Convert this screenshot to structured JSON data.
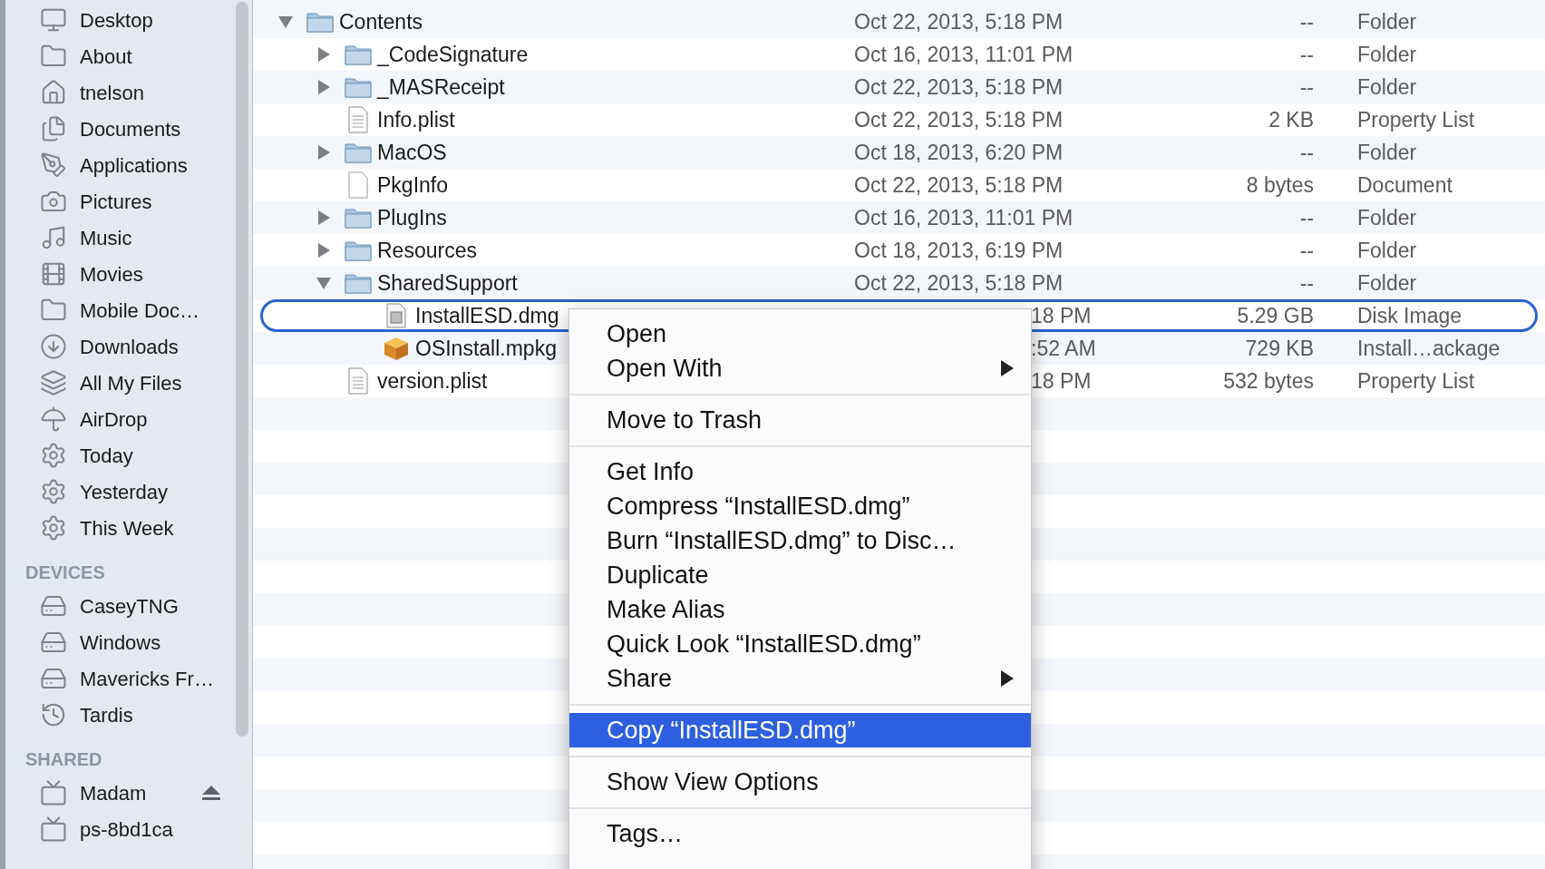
{
  "sidebar": {
    "favorites": [
      {
        "label": "Desktop"
      },
      {
        "label": "About"
      },
      {
        "label": "tnelson"
      },
      {
        "label": "Documents"
      },
      {
        "label": "Applications"
      },
      {
        "label": "Pictures"
      },
      {
        "label": "Music"
      },
      {
        "label": "Movies"
      },
      {
        "label": "Mobile Doc…"
      },
      {
        "label": "Downloads"
      },
      {
        "label": "All My Files"
      },
      {
        "label": "AirDrop"
      },
      {
        "label": "Today"
      },
      {
        "label": "Yesterday"
      },
      {
        "label": "This Week"
      }
    ],
    "sections": [
      {
        "title": "DEVICES",
        "items": [
          {
            "label": "CaseyTNG",
            "ejectable": false
          },
          {
            "label": "Windows",
            "ejectable": false
          },
          {
            "label": "Mavericks Fr…",
            "ejectable": false
          },
          {
            "label": "Tardis",
            "ejectable": false
          }
        ]
      },
      {
        "title": "SHARED",
        "items": [
          {
            "label": "Madam",
            "ejectable": true
          },
          {
            "label": "ps-8bd1ca",
            "ejectable": false
          }
        ]
      }
    ]
  },
  "files": [
    {
      "name": "Contents",
      "kind": "folder",
      "date": "Oct 22, 2013, 5:18 PM",
      "size": "--",
      "file_kind": "Folder",
      "expanded": true,
      "selected": false,
      "covered": false,
      "children": [
        {
          "name": "_CodeSignature",
          "kind": "folder",
          "date": "Oct 16, 2013, 11:01 PM",
          "size": "--",
          "file_kind": "Folder",
          "expanded": false,
          "selected": false,
          "covered": false
        },
        {
          "name": "_MASReceipt",
          "kind": "folder",
          "date": "Oct 22, 2013, 5:18 PM",
          "size": "--",
          "file_kind": "Folder",
          "expanded": false,
          "selected": false,
          "covered": false
        },
        {
          "name": "Info.plist",
          "kind": "document",
          "date": "Oct 22, 2013, 5:18 PM",
          "size": "2 KB",
          "file_kind": "Property List",
          "selected": false,
          "covered": false
        },
        {
          "name": "MacOS",
          "kind": "folder",
          "date": "Oct 18, 2013, 6:20 PM",
          "size": "--",
          "file_kind": "Folder",
          "expanded": false,
          "selected": false,
          "covered": false
        },
        {
          "name": "PkgInfo",
          "kind": "blank",
          "date": "Oct 22, 2013, 5:18 PM",
          "size": "8 bytes",
          "file_kind": "Document",
          "selected": false,
          "covered": false
        },
        {
          "name": "PlugIns",
          "kind": "folder",
          "date": "Oct 16, 2013, 11:01 PM",
          "size": "--",
          "file_kind": "Folder",
          "expanded": false,
          "selected": false,
          "covered": false
        },
        {
          "name": "Resources",
          "kind": "folder",
          "date": "Oct 18, 2013, 6:19 PM",
          "size": "--",
          "file_kind": "Folder",
          "expanded": false,
          "selected": false,
          "covered": false
        },
        {
          "name": "SharedSupport",
          "kind": "folder",
          "date": "Oct 22, 2013, 5:18 PM",
          "size": "--",
          "file_kind": "Folder",
          "expanded": true,
          "selected": false,
          "covered": false,
          "children": [
            {
              "name": "InstallESD.dmg",
              "kind": "disk",
              "date": "18 PM",
              "size": "5.29 GB",
              "file_kind": "Disk Image",
              "selected": true,
              "covered": true
            },
            {
              "name": "OSInstall.mpkg",
              "kind": "package",
              "date": ":52 AM",
              "size": "729 KB",
              "file_kind": "Install…ackage",
              "selected": false,
              "covered": true
            }
          ]
        },
        {
          "name": "version.plist",
          "kind": "document",
          "date": "18 PM",
          "size": "532 bytes",
          "file_kind": "Property List",
          "selected": false,
          "covered": true
        }
      ]
    }
  ],
  "context_menu": [
    {
      "kind": "item",
      "label": "Open",
      "submenu": false,
      "selected": false
    },
    {
      "kind": "item",
      "label": "Open With",
      "submenu": true,
      "selected": false
    },
    {
      "kind": "separator"
    },
    {
      "kind": "item",
      "label": "Move to Trash",
      "submenu": false,
      "selected": false
    },
    {
      "kind": "separator"
    },
    {
      "kind": "item",
      "label": "Get Info",
      "submenu": false,
      "selected": false
    },
    {
      "kind": "item",
      "label": "Compress “InstallESD.dmg”",
      "submenu": false,
      "selected": false
    },
    {
      "kind": "item",
      "label": "Burn “InstallESD.dmg” to Disc…",
      "submenu": false,
      "selected": false
    },
    {
      "kind": "item",
      "label": "Duplicate",
      "submenu": false,
      "selected": false
    },
    {
      "kind": "item",
      "label": "Make Alias",
      "submenu": false,
      "selected": false
    },
    {
      "kind": "item",
      "label": "Quick Look “InstallESD.dmg”",
      "submenu": false,
      "selected": false
    },
    {
      "kind": "item",
      "label": "Share",
      "submenu": true,
      "selected": false
    },
    {
      "kind": "separator"
    },
    {
      "kind": "item",
      "label": "Copy “InstallESD.dmg”",
      "submenu": false,
      "selected": true
    },
    {
      "kind": "separator"
    },
    {
      "kind": "item",
      "label": "Show View Options",
      "submenu": false,
      "selected": false
    },
    {
      "kind": "separator"
    },
    {
      "kind": "item",
      "label": "Tags…",
      "submenu": false,
      "selected": false
    }
  ]
}
